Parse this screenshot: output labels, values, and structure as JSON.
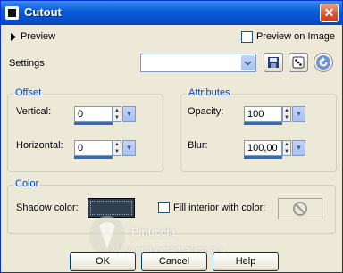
{
  "title": "Cutout",
  "preview": {
    "label": "Preview",
    "on_image_label": "Preview on Image"
  },
  "settings": {
    "label": "Settings",
    "value": ""
  },
  "offset": {
    "title": "Offset",
    "vertical_label": "Vertical:",
    "vertical_value": "0",
    "horizontal_label": "Horizontal:",
    "horizontal_value": "0"
  },
  "attributes": {
    "title": "Attributes",
    "opacity_label": "Opacity:",
    "opacity_value": "100",
    "blur_label": "Blur:",
    "blur_value": "100,00"
  },
  "color": {
    "title": "Color",
    "shadow_label": "Shadow color:",
    "shadow_color": "#2f4150",
    "fill_label": "Fill interior with color:"
  },
  "buttons": {
    "ok": "OK",
    "cancel": "Cancel",
    "help": "Help"
  },
  "watermark": {
    "line1": "Pinuccia",
    "line2": "www.pinucciagrafica.eu"
  },
  "icons": {
    "app": "app-icon",
    "close": "close-icon",
    "expand": "triangle-right-icon",
    "save": "floppy-disk-icon",
    "randomize": "dice-icon",
    "reset": "reset-icon",
    "disabled_fill": "no-sign-icon"
  }
}
